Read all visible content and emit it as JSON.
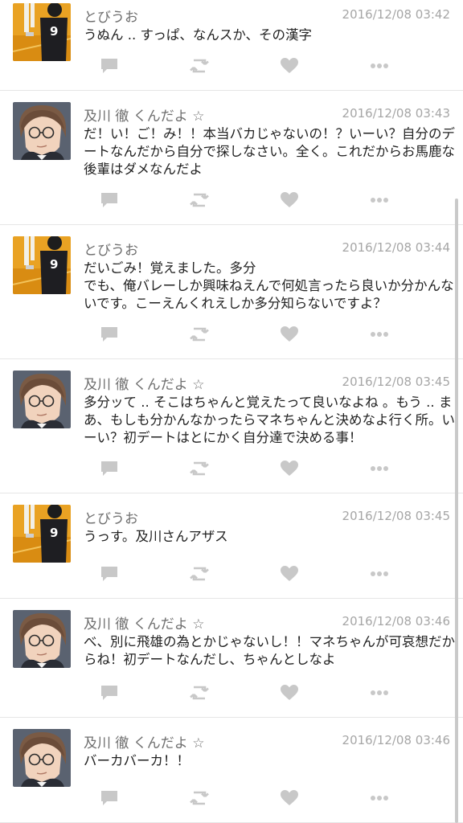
{
  "feed": {
    "tweets": [
      {
        "user": "とびうお",
        "avatar": "tobio-avatar",
        "time": "2016/12/08 03:42",
        "text": "うぬん .. すっぱ、なんスか、その漢字"
      },
      {
        "user": "及川 徹 くんだよ ☆",
        "avatar": "oikawa-avatar",
        "time": "2016/12/08 03:43",
        "text": "だ！い！ご！み！！本当バカじゃないの！？いーい？自分のデートなんだから自分で探しなさい。全く。これだからお馬鹿な後輩はダメなんだよ"
      },
      {
        "user": "とびうお",
        "avatar": "tobio-avatar",
        "time": "2016/12/08 03:44",
        "text": "だいごみ！覚えました。多分\nでも、俺バレーしか興味ねえんで何処言ったら良いか分かんないです。こーえんくれえしか多分知らないですよ？"
      },
      {
        "user": "及川 徹 くんだよ ☆",
        "avatar": "oikawa-avatar",
        "time": "2016/12/08 03:45",
        "text": "多分ッて .. そこはちゃんと覚えたって良いなよね 。もう .. まあ、もしも分かんなかったらマネちゃんと決めなよ行く所。いーい？初デートはとにかく自分達で決める事！"
      },
      {
        "user": "とびうお",
        "avatar": "tobio-avatar",
        "time": "2016/12/08 03:45",
        "text": "うっす。及川さんアザス"
      },
      {
        "user": "及川 徹 くんだよ ☆",
        "avatar": "oikawa-avatar",
        "time": "2016/12/08 03:46",
        "text": "べ、別に飛雄の為とかじゃないし！！マネちゃんが可哀想だからね！初デートなんだし、ちゃんとしなよ"
      },
      {
        "user": "及川 徹 くんだよ ☆",
        "avatar": "oikawa-avatar",
        "time": "2016/12/08 03:46",
        "text": "バーカバーカ！！"
      }
    ]
  },
  "icons": {
    "reply": "reply-icon",
    "retweet": "retweet-icon",
    "like": "heart-icon",
    "more": "more-icon"
  },
  "colors": {
    "icon": "#c8c8c8",
    "name": "#6f6f6f",
    "time": "#a6a6a6",
    "text": "#222222"
  }
}
